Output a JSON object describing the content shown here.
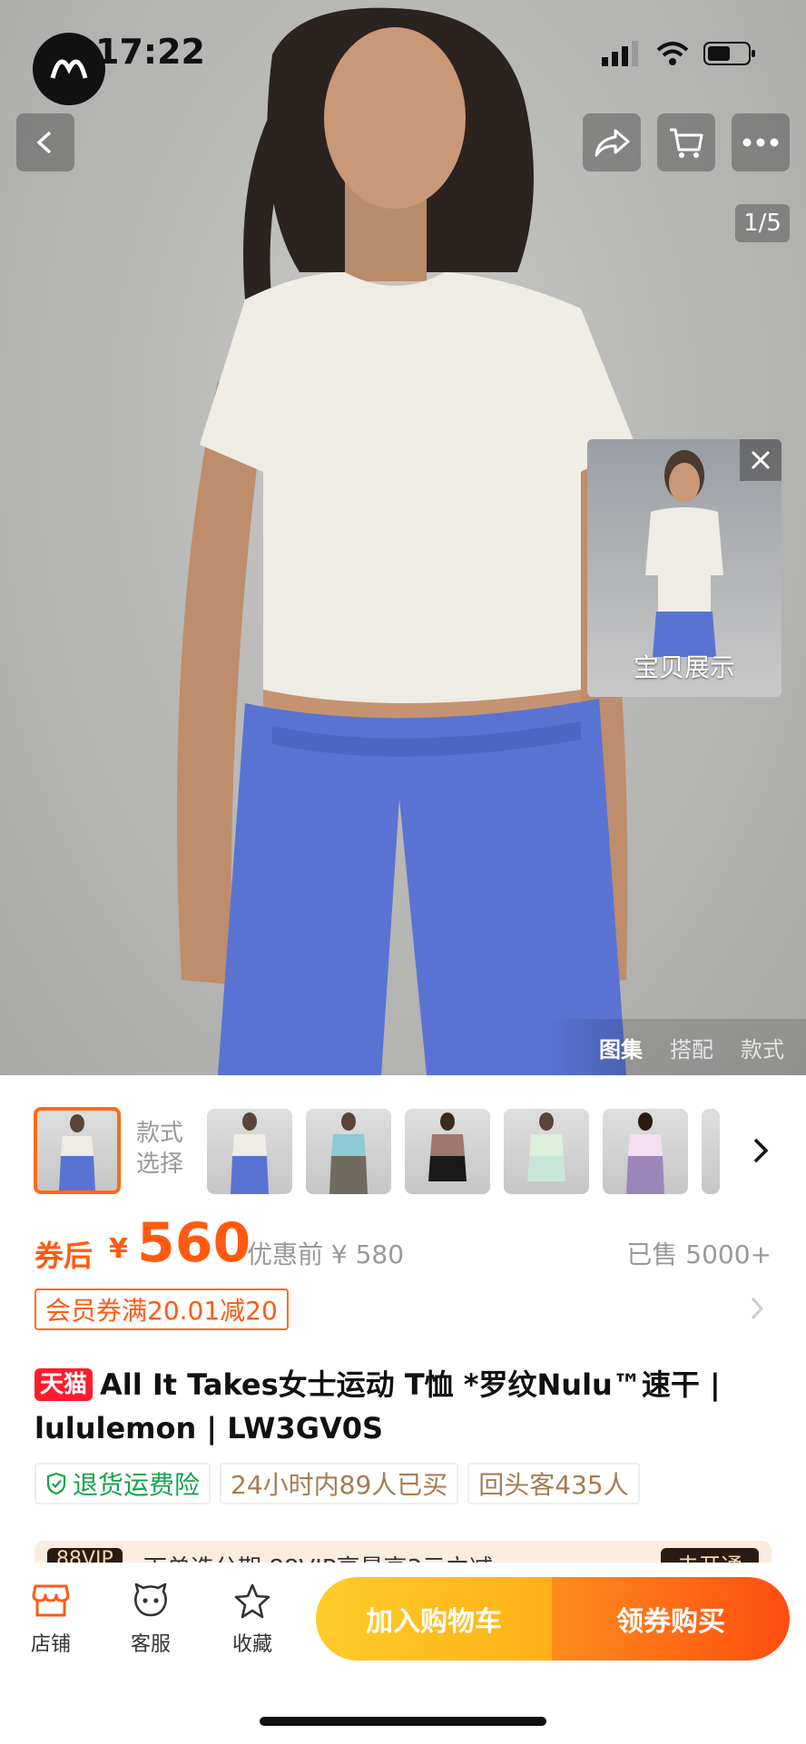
{
  "status": {
    "time": "17:22"
  },
  "hero": {
    "image_counter": "1/5",
    "pip_label": "宝贝展示",
    "tabs": [
      "图集",
      "搭配",
      "款式"
    ]
  },
  "variants": {
    "style_label": "款式\n选择"
  },
  "price": {
    "tag": "券后",
    "currency": "¥",
    "value": "560",
    "original": "优惠前 ¥ 580",
    "sold": "已售 5000+"
  },
  "coupon": {
    "label": "会员券满20.01减20"
  },
  "title": {
    "badge": "天猫",
    "text": "All It Takes女士运动 T恤 *罗纹Nulu™速干 | lululemon | LW3GV0S"
  },
  "tags": [
    "退货运费险",
    "24小时内89人已买",
    "回头客435人"
  ],
  "vip": {
    "badge": "88VIP",
    "text": "下单选分期 88VIP享最高3元立减",
    "button": "去开通"
  },
  "bottom_bar": {
    "store": "店铺",
    "service": "客服",
    "favorite": "收藏",
    "add_cart": "加入购物车",
    "buy": "领券购买"
  },
  "colors": {
    "accent": "#ff5a12",
    "tmall": "#ff1b2d",
    "cart": "#ffb017"
  }
}
